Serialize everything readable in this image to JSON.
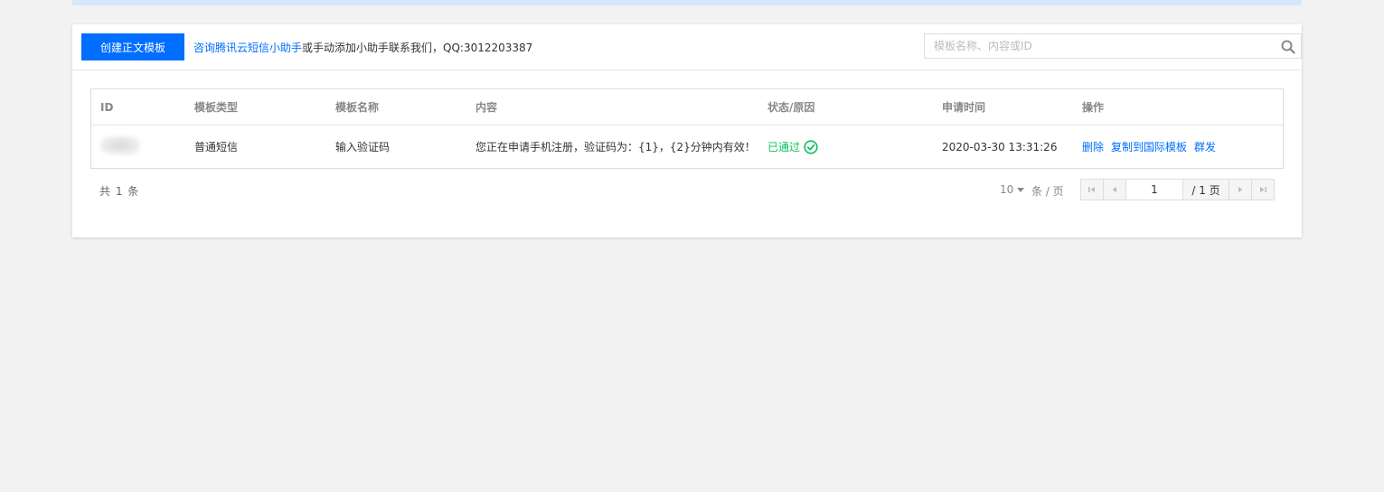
{
  "toolbar": {
    "create_label": "创建正文模板",
    "help_link": "咨询腾讯云短信小助手",
    "help_rest": "或手动添加小助手联系我们，QQ:3012203387",
    "search_placeholder": "模板名称、内容或ID"
  },
  "table": {
    "headers": [
      "ID",
      "模板类型",
      "模板名称",
      "内容",
      "状态/原因",
      "申请时间",
      "操作"
    ],
    "rows": [
      {
        "id": "",
        "type": "普通短信",
        "name": "输入验证码",
        "content": "您正在申请手机注册，验证码为：{1}，{2}分钟内有效！",
        "status": "已通过",
        "time": "2020-03-30 13:31:26",
        "actions": [
          "删除",
          "复制到国际模板",
          "群发"
        ]
      }
    ]
  },
  "footer": {
    "total": "共 1 条",
    "page_size": "10",
    "per_page_label": "条 / 页",
    "current_page": "1",
    "total_pages": "/ 1 页"
  },
  "colors": {
    "primary": "#006eff",
    "success": "#0abf5b",
    "banner": "#d5e7fc",
    "background": "#f2f2f2"
  },
  "icons": {
    "search": "search-icon",
    "status": "check-circle-icon",
    "pager": [
      "first-page-icon",
      "prev-page-icon",
      "next-page-icon",
      "last-page-icon"
    ]
  }
}
